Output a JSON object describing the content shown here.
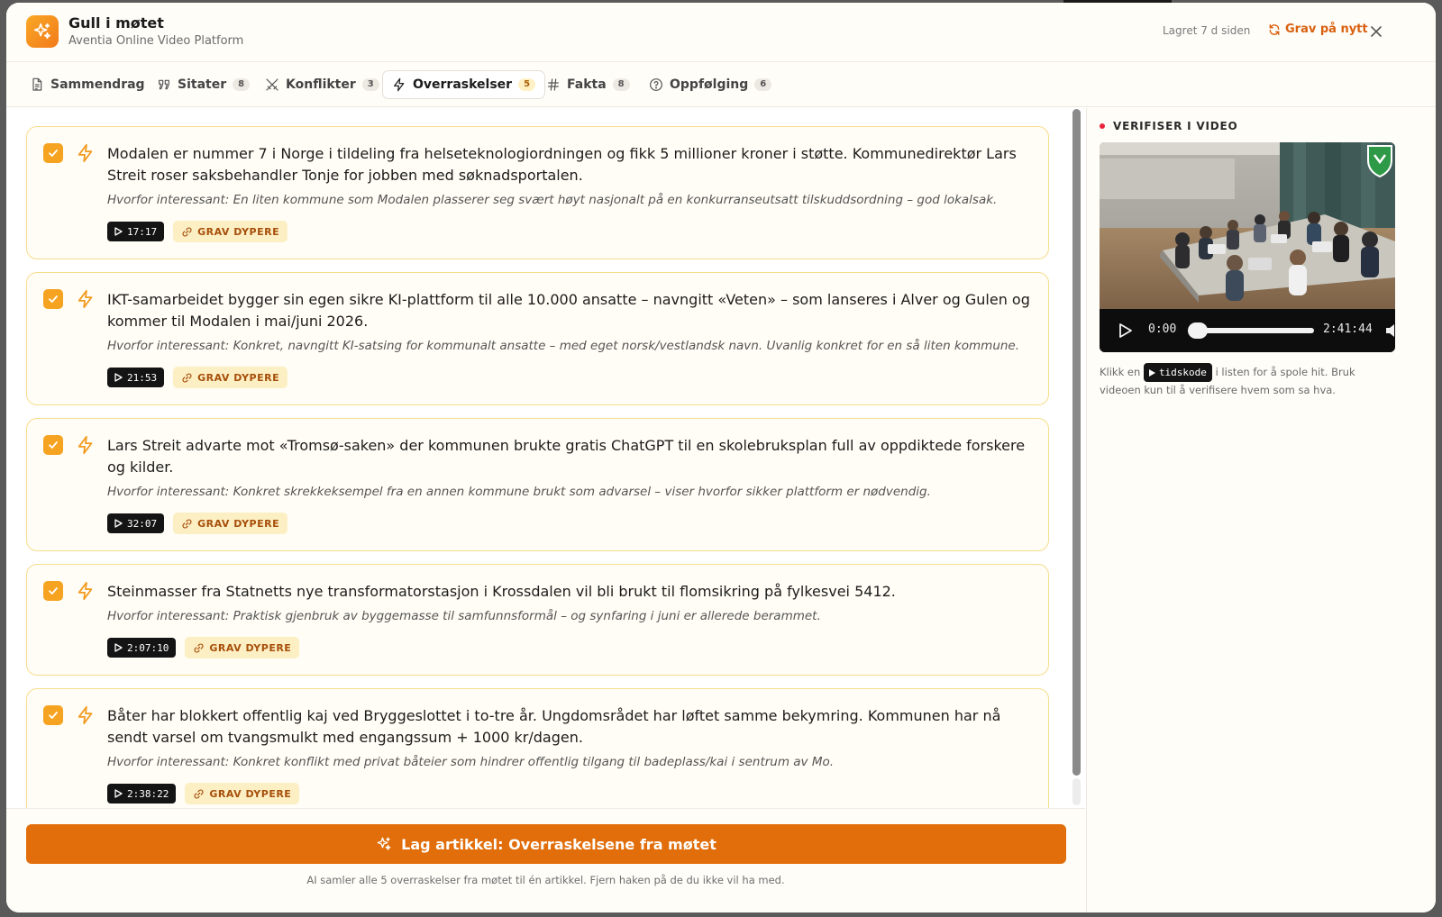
{
  "header": {
    "title": "Gull i møtet",
    "subtitle": "Aventia Online Video Platform",
    "saved": "Lagret 7 d siden",
    "regrave_label": "Grav på nytt"
  },
  "tabs": [
    {
      "label": "Sammendrag",
      "badge": "",
      "icon": "document-icon"
    },
    {
      "label": "Sitater",
      "badge": "8",
      "icon": "quote-icon"
    },
    {
      "label": "Konflikter",
      "badge": "3",
      "icon": "crossed-swords-icon"
    },
    {
      "label": "Overraskelser",
      "badge": "5",
      "icon": "lightning-icon",
      "active": true
    },
    {
      "label": "Fakta",
      "badge": "8",
      "icon": "hash-icon"
    },
    {
      "label": "Oppfølging",
      "badge": "6",
      "icon": "question-circle-icon"
    }
  ],
  "items": [
    {
      "text": "Modalen er nummer 7 i Norge i tildeling fra helseteknologiordningen og fikk 5 millioner kroner i støtte. Kommunedirektør Lars Streit roser saksbehandler Tonje for jobben med søknadsportalen.",
      "why": "Hvorfor interessant: En liten kommune som Modalen plasserer seg svært høyt nasjonalt på en konkurranseutsatt tilskuddsordning – god lokalsak.",
      "timecode": "17:17",
      "checked": true
    },
    {
      "text": "IKT-samarbeidet bygger sin egen sikre KI-plattform til alle 10.000 ansatte – navngitt «Veten» – som lanseres i Alver og Gulen og kommer til Modalen i mai/juni 2026.",
      "why": "Hvorfor interessant: Konkret, navngitt KI-satsing for kommunalt ansatte – med eget norsk/vestlandsk navn. Uvanlig konkret for en så liten kommune.",
      "timecode": "21:53",
      "checked": true
    },
    {
      "text": "Lars Streit advarte mot «Tromsø-saken» der kommunen brukte gratis ChatGPT til en skolebruksplan full av oppdiktede forskere og kilder.",
      "why": "Hvorfor interessant: Konkret skrekkeksempel fra en annen kommune brukt som advarsel – viser hvorfor sikker plattform er nødvendig.",
      "timecode": "32:07",
      "checked": true
    },
    {
      "text": "Steinmasser fra Statnetts nye transformatorstasjon i Krossdalen vil bli brukt til flomsikring på fylkesvei 5412.",
      "why": "Hvorfor interessant: Praktisk gjenbruk av byggemasse til samfunnsformål – og synfaring i juni er allerede berammet.",
      "timecode": "2:07:10",
      "checked": true
    },
    {
      "text": "Båter har blokkert offentlig kaj ved Bryggeslottet i to-tre år. Ungdomsrådet har løftet samme bekymring. Kommunen har nå sendt varsel om tvangsmulkt med engangssum + 1000 kr/dagen.",
      "why": "Hvorfor interessant: Konkret konflikt med privat båteier som hindrer offentlig tilgang til badeplass/kai i sentrum av Mo.",
      "timecode": "2:38:22",
      "checked": true
    }
  ],
  "dig_label": "GRAV DYPERE",
  "footer": {
    "cta_label": "Lag artikkel: Overraskelsene fra møtet",
    "note": "AI samler alle 5 overraskelser fra møtet til én artikkel. Fjern haken på de du ikke vil ha med."
  },
  "side": {
    "heading": "VERIFISER I VIDEO",
    "current_time": "0:00",
    "duration": "2:41:44",
    "progress": 0,
    "note_before": "Klikk en",
    "note_code": "tidskode",
    "note_after": "i listen for å spole hit. Bruk videoen kun til å verifisere hvem som sa hva."
  },
  "colors": {
    "accent": "#e16e0a",
    "card_border": "#f7dd8d",
    "checkbox": "#f6a321",
    "live": "#e8243d"
  }
}
